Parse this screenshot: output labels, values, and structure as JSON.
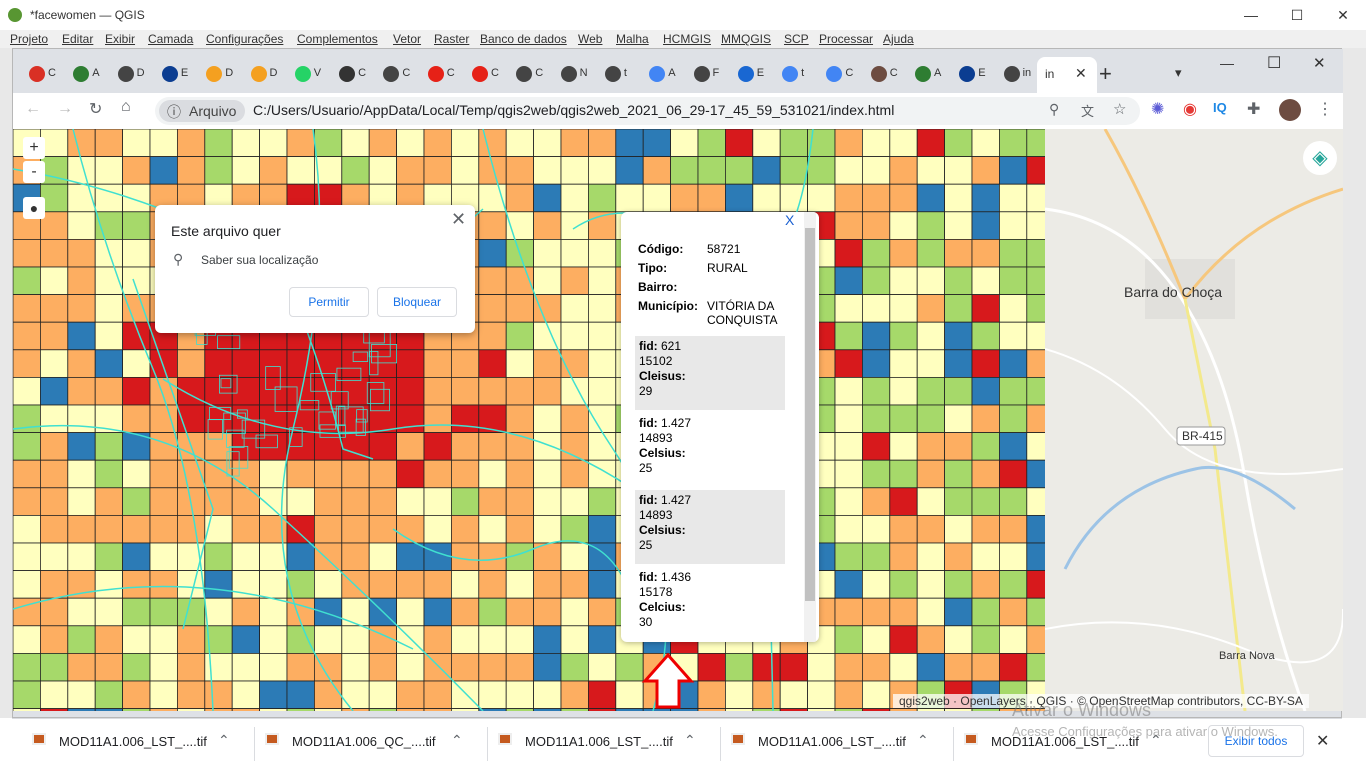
{
  "qgis": {
    "title": "*facewomen — QGIS",
    "minimize": "—",
    "maximize": "☐",
    "close": "✕",
    "menu": [
      "Projeto",
      "Editar",
      "Exibir",
      "Camada",
      "Configurações",
      "Complementos",
      "Vetor",
      "Raster",
      "Banco de dados",
      "Web",
      "Malha",
      "HCMGIS",
      "MMQGIS",
      "SCP",
      "Processar",
      "Ajuda"
    ]
  },
  "chrome": {
    "tabs": [
      {
        "t": "C",
        "color": "#d93025"
      },
      {
        "t": "A",
        "color": "#2e7d32"
      },
      {
        "t": "D",
        "color": "#444"
      },
      {
        "t": "E",
        "color": "#0b3d91"
      },
      {
        "t": "D",
        "color": "#f4a020"
      },
      {
        "t": "D",
        "color": "#f4a020"
      },
      {
        "t": "V",
        "color": "#25d366"
      },
      {
        "t": "C",
        "color": "#333"
      },
      {
        "t": "C",
        "color": "#444"
      },
      {
        "t": "C",
        "color": "#e62117"
      },
      {
        "t": "C",
        "color": "#e62117"
      },
      {
        "t": "C",
        "color": "#444"
      },
      {
        "t": "N",
        "color": "#444"
      },
      {
        "t": "t",
        "color": "#444"
      },
      {
        "t": "A",
        "color": "#4285f4"
      },
      {
        "t": "F",
        "color": "#444"
      },
      {
        "t": "E",
        "color": "#1967d2"
      },
      {
        "t": "t",
        "color": "#4285f4"
      },
      {
        "t": "C",
        "color": "#4285f4"
      },
      {
        "t": "C",
        "color": "#6d4c41"
      },
      {
        "t": "A",
        "color": "#2e7d32"
      },
      {
        "t": "E",
        "color": "#0b3d91"
      },
      {
        "t": "in",
        "color": "#444"
      }
    ],
    "active_tab": "in",
    "new_tab": "+",
    "win_min": "—",
    "win_max": "☐",
    "win_close": "✕",
    "arquivo": "Arquivo",
    "url": "C:/Users/Usuario/AppData/Local/Temp/qgis2web/qgis2web_2021_06_29-17_45_59_531021/index.html"
  },
  "permission": {
    "title": "Este arquivo quer",
    "message": "Saber sua localização",
    "allow": "Permitir",
    "block": "Bloquear"
  },
  "map": {
    "zoom_in": "+",
    "zoom_out": "-",
    "places": [
      "Barra do Choça",
      "Barra Nova"
    ],
    "road": "BR-415",
    "attribution": "qgis2web · OpenLayers · QGIS · © OpenStreetMap contributors, CC-BY-SA"
  },
  "popup": {
    "close": "X",
    "codigo_label": "Código:",
    "codigo": "58721",
    "tipo_label": "Tipo:",
    "tipo": "RURAL",
    "bairro_label": "Bairro:",
    "municipio_label": "Município:",
    "municipio": "VITÓRIA DA CONQUISTA",
    "records": [
      {
        "fid_label": "fid:",
        "fid": "621",
        "val": "15102",
        "temp_label": "Cleisus:",
        "temp": "29"
      },
      {
        "fid_label": "fid:",
        "fid": "1.427",
        "val": "14893",
        "temp_label": "Celsius:",
        "temp": "25"
      },
      {
        "fid_label": "fid:",
        "fid": "1.427",
        "val": "14893",
        "temp_label": "Celsius:",
        "temp": "25"
      },
      {
        "fid_label": "fid:",
        "fid": "1.436",
        "val": "15178",
        "temp_label": "Celcius:",
        "temp": "30"
      }
    ]
  },
  "downloads": {
    "files": [
      "MOD11A1.006_LST_....tif",
      "MOD11A1.006_QC_....tif",
      "MOD11A1.006_LST_....tif",
      "MOD11A1.006_LST_....tif",
      "MOD11A1.006_LST_....tif"
    ],
    "show_all": "Exibir todos",
    "close": "✕"
  },
  "watermark": {
    "line1": "Ativar o Windows",
    "line2": "Acesse Configurações para ativar o Windows."
  },
  "colors": {
    "red": "#d7191c",
    "orange": "#fdae61",
    "yellow": "#ffffbf",
    "green": "#a6d96a",
    "blue": "#2c7bb6"
  }
}
